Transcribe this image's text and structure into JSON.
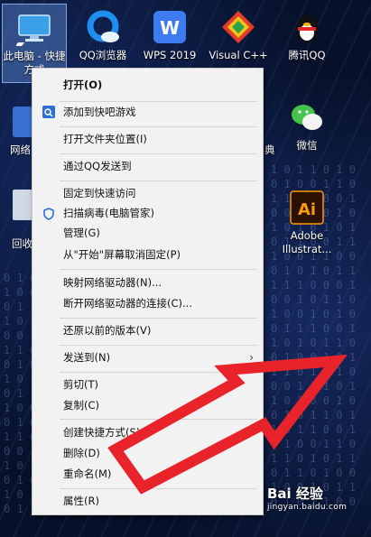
{
  "desktop": {
    "icons": [
      {
        "id": "this-pc",
        "label": "此电脑 - 快捷方式",
        "selected": true
      },
      {
        "id": "qq-browser",
        "label": "QQ浏览器"
      },
      {
        "id": "wps",
        "label": "WPS 2019"
      },
      {
        "id": "visual-cpp",
        "label": "Visual C++"
      },
      {
        "id": "tencent-qq",
        "label": "腾讯QQ"
      },
      {
        "id": "wechat",
        "label": "微信"
      },
      {
        "id": "illustrator",
        "label": "Adobe Illustrat..."
      }
    ],
    "partial_labels": [
      "网络",
      "回收",
      "典"
    ]
  },
  "context_menu": {
    "open": "打开(O)",
    "add_game": "添加到快吧游戏",
    "open_folder": "打开文件夹位置(I)",
    "qq_send": "通过QQ发送到",
    "pin_quick": "固定到快速访问",
    "scan_virus": "扫描病毒(电脑管家)",
    "manage": "管理(G)",
    "unpin_start": "从\"开始\"屏幕取消固定(P)",
    "map_drive": "映射网络驱动器(N)...",
    "disconnect_drive": "断开网络驱动器的连接(C)...",
    "restore": "还原以前的版本(V)",
    "send_to": "发送到(N)",
    "cut": "剪切(T)",
    "copy": "复制(C)",
    "create_shortcut": "创建快捷方式(S)",
    "delete": "删除(D)",
    "rename": "重命名(M)",
    "properties": "属性(R)"
  },
  "annotation": {
    "arrow_color": "#e8242a"
  },
  "watermark": {
    "main": "Bai 经验",
    "sub": "jingyan.baidu.com"
  }
}
